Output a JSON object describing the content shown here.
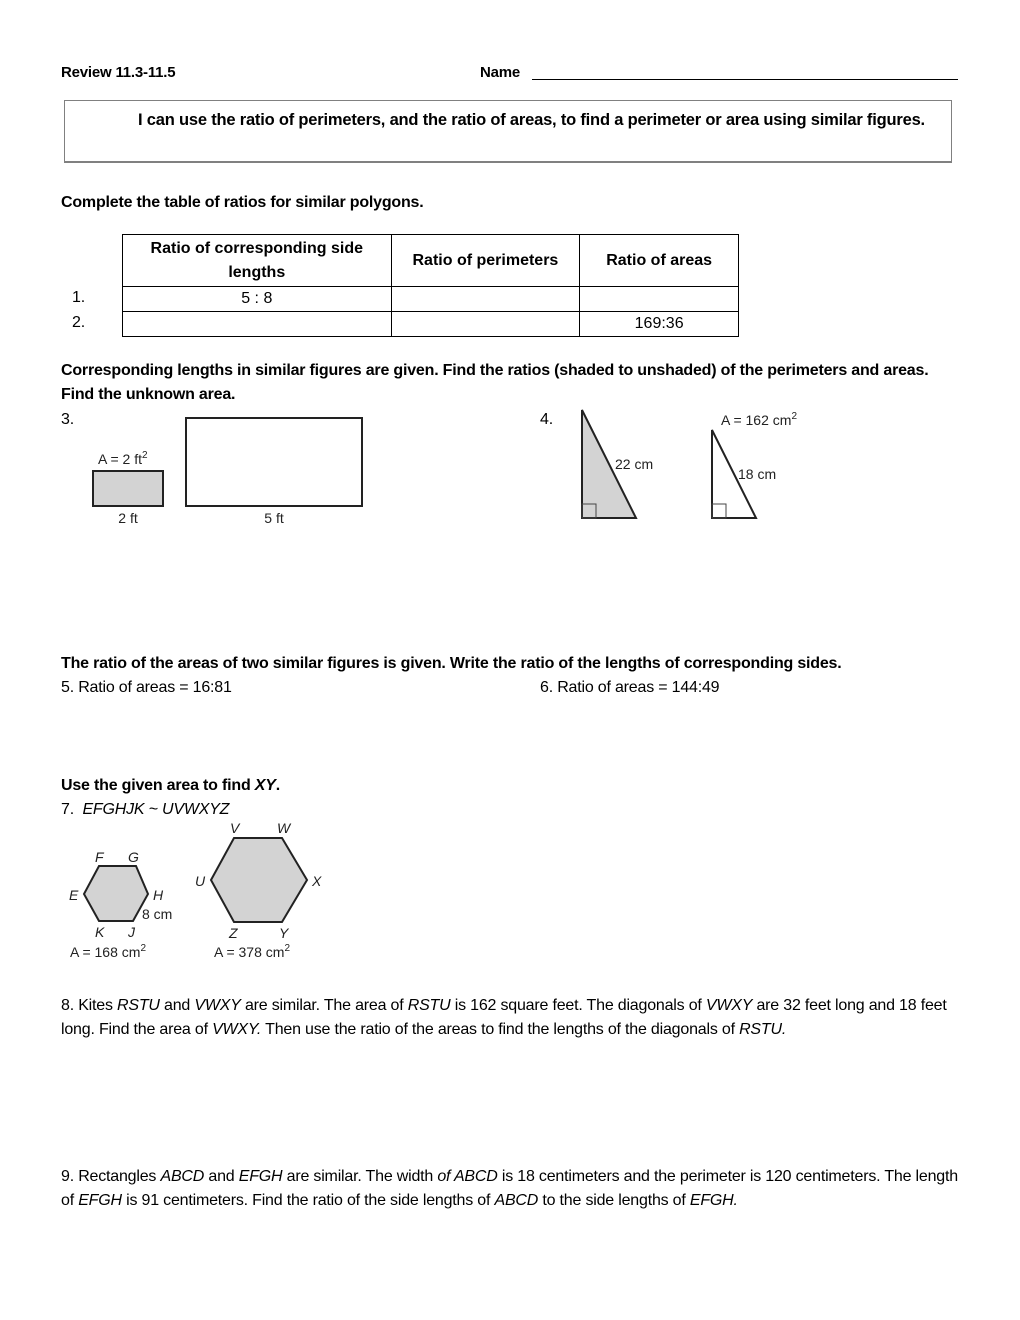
{
  "header": {
    "title": "Review 11.3-11.5",
    "name_label": "Name"
  },
  "objective": "I can use the ratio of perimeters, and the ratio of areas, to find a perimeter or area using similar figures.",
  "section_table": {
    "instruction": "Complete the table of ratios for similar polygons.",
    "columns": [
      "Ratio of corresponding side lengths",
      "Ratio of perimeters",
      "Ratio of areas"
    ],
    "rows": [
      {
        "number": "1.",
        "cells": [
          "5 : 8",
          "",
          ""
        ]
      },
      {
        "number": "2.",
        "cells": [
          "",
          "",
          "169:36"
        ]
      }
    ]
  },
  "section_figures": {
    "instruction": "Corresponding lengths in similar figures are given. Find the ratios (shaded to unshaded) of the perimeters and areas. Find the unknown area.",
    "problem3": {
      "number": "3.",
      "shaded_area": "A = 2 ft",
      "shaded_area_exp": "2",
      "shaded_side": "2 ft",
      "unshaded_side": "5 ft"
    },
    "problem4": {
      "number": "4.",
      "shaded_side": "22 cm",
      "unshaded_side": "18 cm",
      "unshaded_area": "A = 162 cm",
      "unshaded_area_exp": "2"
    }
  },
  "section_area_ratio": {
    "instruction": "The ratio of the areas of two similar figures is given. Write the ratio of the lengths of corresponding sides.",
    "problem5": "5.  Ratio of areas = 16:81",
    "problem6": "6.  Ratio of areas = 144:49"
  },
  "section_xy": {
    "instruction_prefix": "Use the given area to find ",
    "instruction_var": "XY",
    "instruction_suffix": ".",
    "problem7_number": "7.",
    "problem7_statement": "EFGHJK ~ UVWXYZ",
    "small_hex": {
      "vertices": [
        "E",
        "F",
        "G",
        "H",
        "J",
        "K"
      ],
      "side": "8 cm",
      "area": "A = 168 cm",
      "area_exp": "2"
    },
    "large_hex": {
      "vertices": [
        "U",
        "V",
        "W",
        "X",
        "Y",
        "Z"
      ],
      "area": "A = 378 cm",
      "area_exp": "2"
    }
  },
  "problem8": {
    "parts": [
      {
        "text": "8.  Kites ",
        "italic": false
      },
      {
        "text": "RSTU",
        "italic": true
      },
      {
        "text": " and ",
        "italic": false
      },
      {
        "text": "VWXY",
        "italic": true
      },
      {
        "text": " are similar. The area of ",
        "italic": false
      },
      {
        "text": "RSTU",
        "italic": true
      },
      {
        "text": " is 162 square feet. The diagonals of ",
        "italic": false
      },
      {
        "text": "VWXY",
        "italic": true
      },
      {
        "text": " are 32 feet long and 18 feet long. Find the area of ",
        "italic": false
      },
      {
        "text": "VWXY.",
        "italic": true
      },
      {
        "text": " Then use the ratio of the areas to find the lengths of the diagonals of ",
        "italic": false
      },
      {
        "text": "RSTU.",
        "italic": true
      }
    ]
  },
  "problem9": {
    "parts": [
      {
        "text": "9.  Rectangles ",
        "italic": false
      },
      {
        "text": "ABCD",
        "italic": true
      },
      {
        "text": " and ",
        "italic": false
      },
      {
        "text": "EFGH",
        "italic": true
      },
      {
        "text": " are similar. The width ",
        "italic": false
      },
      {
        "text": "of ABCD",
        "italic": true
      },
      {
        "text": " is 18 centimeters and the perimeter is 120 centimeters. The length of ",
        "italic": false
      },
      {
        "text": "EFGH",
        "italic": true
      },
      {
        "text": " is 91 centimeters. Find the ratio of the side lengths of ",
        "italic": false
      },
      {
        "text": "ABCD",
        "italic": true
      },
      {
        "text": " to the side lengths of ",
        "italic": false
      },
      {
        "text": "EFGH.",
        "italic": true
      }
    ]
  },
  "colors": {
    "shade": "#d3d3d3",
    "stroke": "#222222",
    "box_border": "#808080"
  }
}
